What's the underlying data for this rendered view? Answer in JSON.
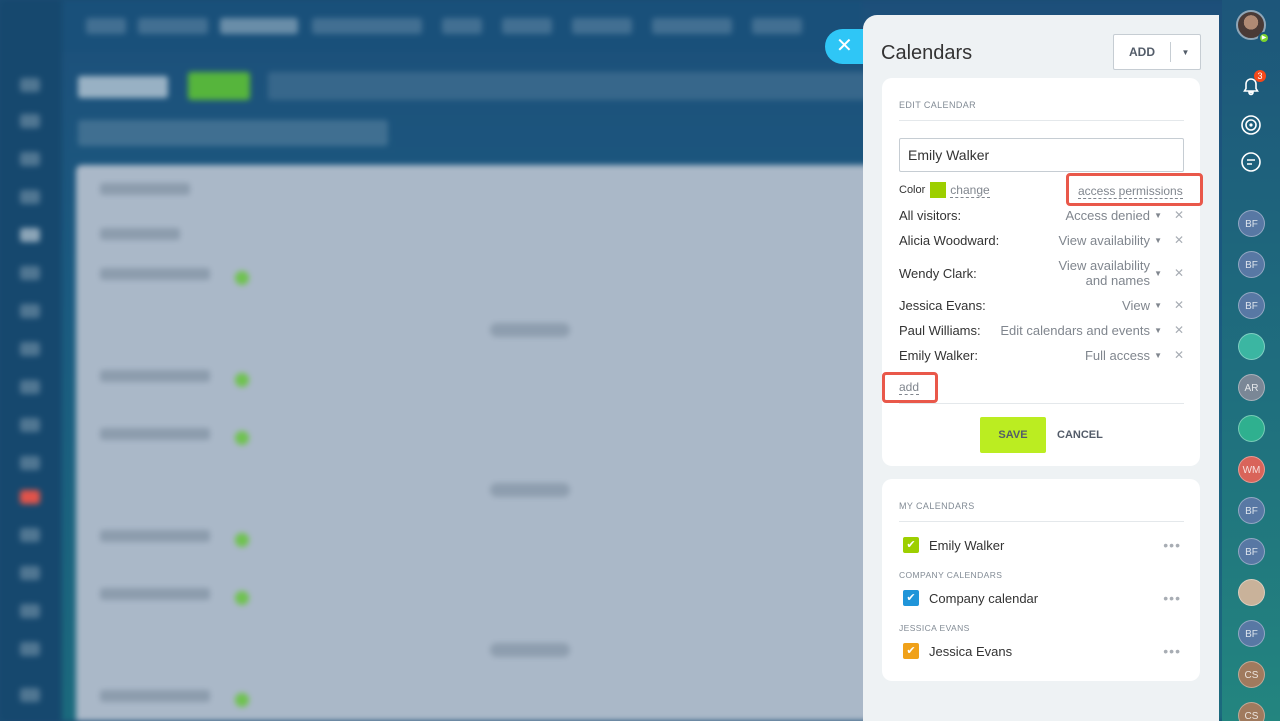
{
  "colors": {
    "accent_green": "#bbed21",
    "calendar_color": "#9dcf00",
    "highlight": "#e9584a",
    "close_button": "#2fc6f6"
  },
  "panel": {
    "title": "Calendars",
    "add_label": "ADD",
    "close_icon": "close-icon",
    "edit": {
      "section_title": "EDIT CALENDAR",
      "name_value": "Emily Walker",
      "color_label": "Color",
      "change_label": "change",
      "access_label": "access permissions",
      "permissions": [
        {
          "who": "All visitors:",
          "level": "Access denied"
        },
        {
          "who": "Alicia Woodward:",
          "level": "View availability"
        },
        {
          "who": "Wendy Clark:",
          "level": "View availability and names"
        },
        {
          "who": "Jessica Evans:",
          "level": "View"
        },
        {
          "who": "Paul Williams:",
          "level": "Edit calendars and events"
        },
        {
          "who": "Emily Walker:",
          "level": "Full access"
        }
      ],
      "add_label": "add",
      "save_label": "SAVE",
      "cancel_label": "CANCEL"
    },
    "calendars": {
      "my_title": "MY CALENDARS",
      "my_items": [
        {
          "name": "Emily Walker",
          "color": "#9dcf00",
          "checked": true
        }
      ],
      "company_title": "COMPANY CALENDARS",
      "company_items": [
        {
          "name": "Company calendar",
          "color": "#2095d9",
          "checked": true
        }
      ],
      "jessica_title": "JESSICA EVANS",
      "jessica_items": [
        {
          "name": "Jessica Evans",
          "color": "#f0a119",
          "checked": true
        }
      ]
    }
  },
  "right_sidebar": {
    "notification_count": "3",
    "avatars": [
      "BF",
      "BF",
      "BF",
      "",
      "AR",
      "",
      "WM",
      "BF",
      "BF",
      "",
      "BF",
      "CS",
      "CS"
    ]
  }
}
